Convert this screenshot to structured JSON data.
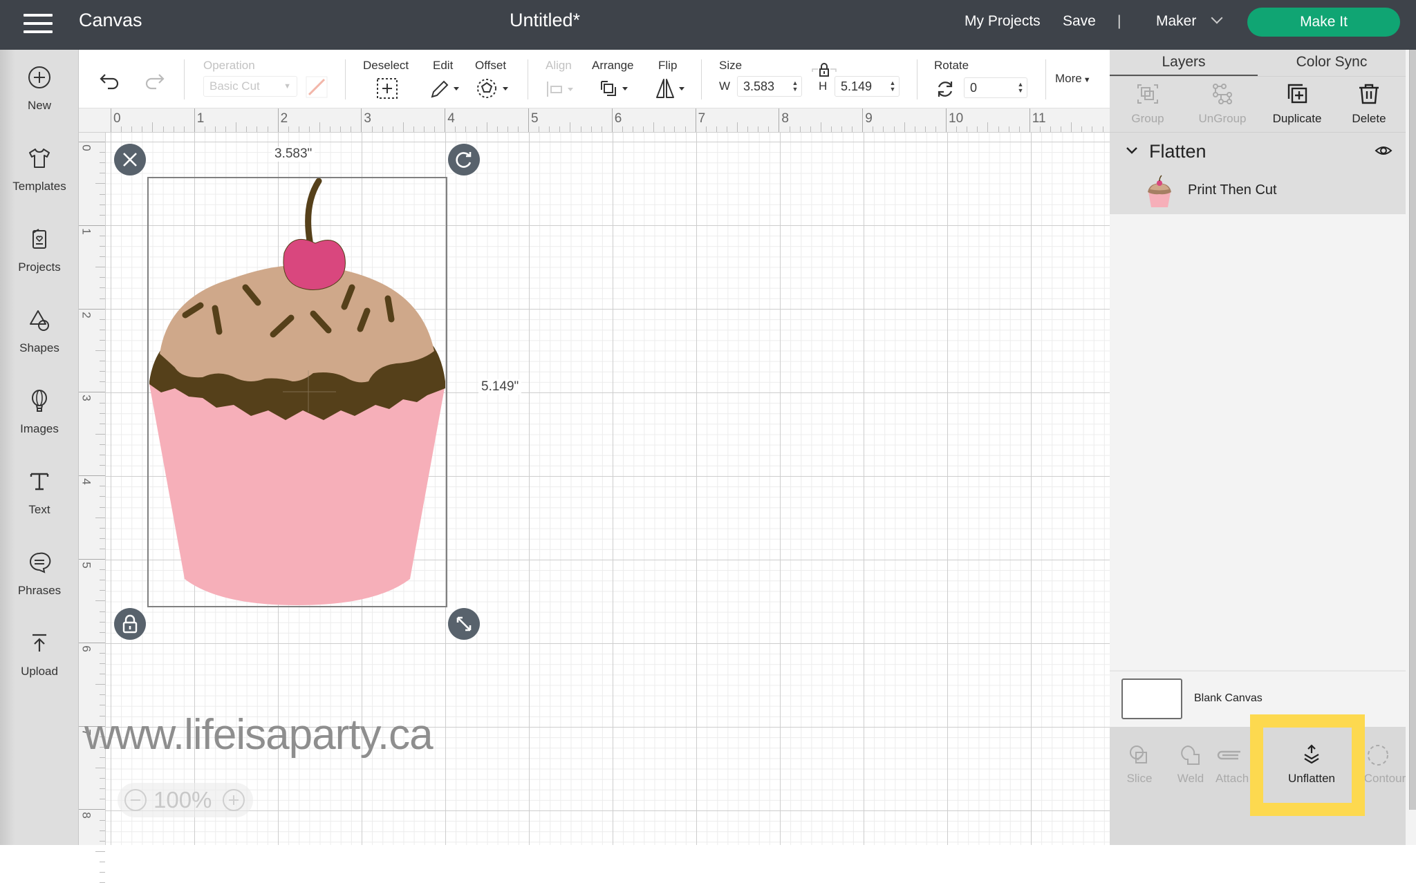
{
  "topbar": {
    "app_title": "Canvas",
    "doc_title": "Untitled*",
    "my_projects": "My Projects",
    "save": "Save",
    "separator": "|",
    "machine": "Maker",
    "make_it": "Make It"
  },
  "sidebar": {
    "items": [
      {
        "label": "New",
        "icon": "plus-circle-icon"
      },
      {
        "label": "Templates",
        "icon": "tshirt-icon"
      },
      {
        "label": "Projects",
        "icon": "card-heart-icon"
      },
      {
        "label": "Shapes",
        "icon": "shapes-icon"
      },
      {
        "label": "Images",
        "icon": "balloon-icon"
      },
      {
        "label": "Text",
        "icon": "text-icon"
      },
      {
        "label": "Phrases",
        "icon": "speech-bubble-icon"
      },
      {
        "label": "Upload",
        "icon": "upload-icon"
      }
    ]
  },
  "toolbar": {
    "operation_label": "Operation",
    "operation_value": "Basic Cut",
    "deselect": "Deselect",
    "edit": "Edit",
    "offset": "Offset",
    "align": "Align",
    "arrange": "Arrange",
    "flip": "Flip",
    "size": "Size",
    "w_label": "W",
    "w_value": "3.583",
    "h_label": "H",
    "h_value": "5.149",
    "rotate": "Rotate",
    "rotate_value": "0",
    "more": "More"
  },
  "canvas": {
    "ruler_top": [
      "0",
      "1",
      "2",
      "3",
      "4",
      "5",
      "6",
      "7",
      "8",
      "9",
      "10",
      "11"
    ],
    "ruler_left": [
      "0",
      "1",
      "2",
      "3",
      "4",
      "5",
      "6",
      "7",
      "8"
    ],
    "width_label": "3.583\"",
    "height_label": "5.149\"",
    "watermark": "www.lifeisaparty.ca",
    "zoom_level": "100%",
    "colors": {
      "cup": "#f6afb9",
      "frosting": "#cfa88a",
      "chocolate": "#55401a",
      "cherry": "#d9477e"
    }
  },
  "right_panel": {
    "tabs": [
      "Layers",
      "Color Sync"
    ],
    "actions": [
      {
        "label": "Group",
        "enabled": false
      },
      {
        "label": "UnGroup",
        "enabled": false
      },
      {
        "label": "Duplicate",
        "enabled": true
      },
      {
        "label": "Delete",
        "enabled": true
      }
    ],
    "group_title": "Flatten",
    "layer_name": "Print Then Cut",
    "blank_canvas": "Blank Canvas",
    "bottom_actions": [
      "Slice",
      "Weld",
      "Attach",
      "Unflatten",
      "Contour"
    ],
    "highlight_color": "#fdd94f"
  }
}
